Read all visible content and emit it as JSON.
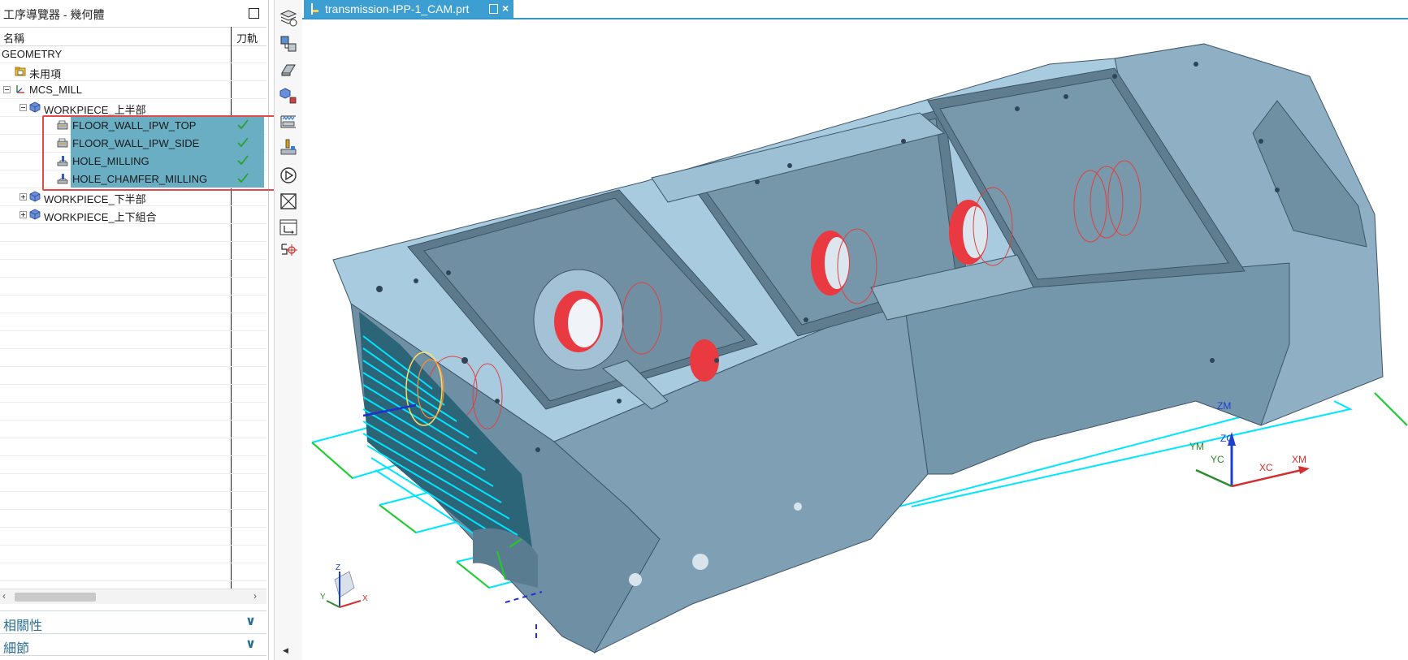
{
  "navigator": {
    "title": "工序導覽器 - 幾何體",
    "columns": {
      "name": "名稱",
      "toolpath": "刀軌"
    },
    "rows": [
      {
        "label": "GEOMETRY"
      },
      {
        "label": "未用項"
      },
      {
        "label": "MCS_MILL"
      },
      {
        "label": "WORKPIECE_上半部"
      },
      {
        "label": "FLOOR_WALL_IPW_TOP",
        "status": "check-icon"
      },
      {
        "label": "FLOOR_WALL_IPW_SIDE",
        "status": "check-icon"
      },
      {
        "label": "HOLE_MILLING",
        "status": "check-icon"
      },
      {
        "label": "HOLE_CHAMFER_MILLING",
        "status": "check-icon"
      },
      {
        "label": "WORKPIECE_下半部"
      },
      {
        "label": "WORKPIECE_上下組合"
      }
    ],
    "sections": [
      {
        "label": "相關性"
      },
      {
        "label": "細節"
      }
    ],
    "selection_color": "#e04a4a"
  },
  "graphics": {
    "tab_title": "transmission-IPP-1_CAM.prt",
    "tab_color": "#3d9fd1",
    "part_color": "#7a9cb0",
    "toolpath_color": "#00e5ff",
    "axes": {
      "zm": "ZM",
      "ym": "YM",
      "zc": "ZC",
      "yc": "YC",
      "xc": "XC",
      "xm": "XM"
    },
    "triad": {
      "x": "X",
      "y": "Y",
      "z": "Z"
    }
  }
}
